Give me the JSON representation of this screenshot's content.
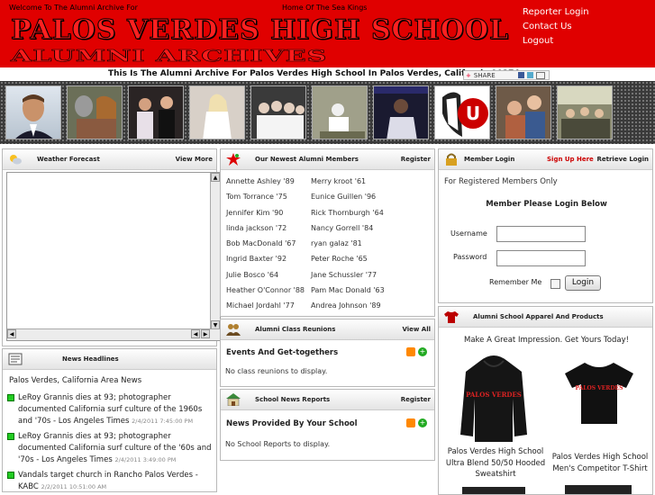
{
  "header": {
    "welcome": "Welcome To The Alumni Archive For",
    "home_of": "Home Of The Sea Kings",
    "school_name": "PALOS VERDES HIGH SCHOOL",
    "echo_text": "ALUMNI ARCHIVES",
    "links": [
      "Reporter Login",
      "Contact Us",
      "Logout"
    ],
    "bg_color": "#e00000"
  },
  "banner": {
    "archive_text": "This Is The Alumni Archive For Palos Verdes High School In Palos Verdes, California 90274",
    "share_label": "SHARE"
  },
  "weather": {
    "title": "Weather Forecast",
    "link": "View More"
  },
  "newest_members": {
    "title": "Our Newest Alumni Members",
    "link": "Register",
    "col1": [
      "Annette Ashley '89",
      "Tom Torrance '75",
      "Jennifer Kim '90",
      "linda jackson '72",
      "Bob MacDonald '67",
      "Ingrid Baxter '92",
      "Julie Bosco '64",
      "Heather O'Connor '88",
      "Michael Jordahl '77"
    ],
    "col2": [
      "Merry kroot '61",
      "Eunice Guillen '96",
      "Rick Thornburgh '64",
      "Nancy Gorrell '84",
      "ryan galaz '81",
      "Peter Roche '65",
      "Jane Schussler '77",
      "Pam Mac Donald '63",
      "Andrea Johnson '89"
    ]
  },
  "member_login": {
    "title": "Member Login",
    "signup": "Sign Up Here",
    "retrieve": "Retrieve Login",
    "registered_only": "For Registered Members Only",
    "please_login": "Member Please Login Below",
    "username_label": "Username",
    "password_label": "Password",
    "remember_label": "Remember Me",
    "login_button": "Login"
  },
  "reunions": {
    "title": "Alumni Class Reunions",
    "link": "View All",
    "subtitle": "Events And Get-togethers",
    "empty": "No class reunions to display."
  },
  "news_headlines": {
    "title": "News Headlines",
    "area": "Palos Verdes, California Area News",
    "items": [
      {
        "text": "LeRoy Grannis dies at 93; photographer documented California surf culture of the 1960s and '70s - Los Angeles Times",
        "date": "2/4/2011 7:45:00 PM"
      },
      {
        "text": "LeRoy Grannis dies at 93; photographer documented California surf culture of the '60s and '70s - Los Angeles Times",
        "date": "2/4/2011 3:49:00 PM"
      },
      {
        "text": "Vandals target church in Rancho Palos Verdes - KABC",
        "date": "2/2/2011 10:51:00 AM"
      }
    ]
  },
  "school_news": {
    "title": "School News Reports",
    "link": "Register",
    "subtitle": "News Provided By Your School",
    "empty": "No School Reports to display."
  },
  "apparel": {
    "title": "Alumni School Apparel And Products",
    "tagline": "Make A Great Impression. Get Yours Today!",
    "products": [
      {
        "caption": "Palos Verdes High School Ultra Blend 50/50 Hooded Sweatshirt"
      },
      {
        "caption": "Palos Verdes High School Men's Competitor T-Shirt"
      }
    ]
  }
}
